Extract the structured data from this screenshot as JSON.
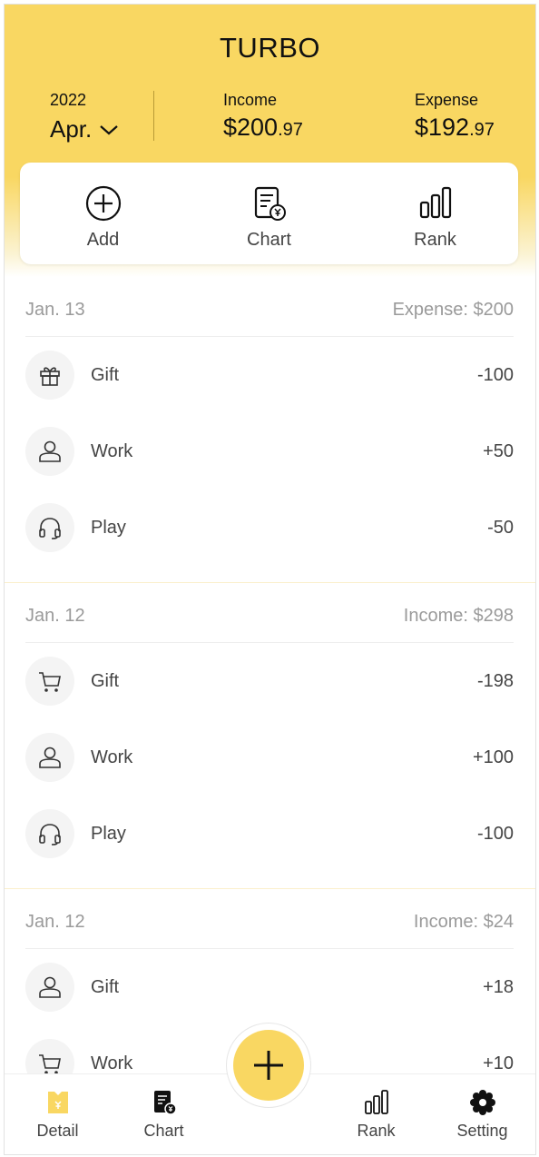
{
  "header": {
    "title": "TURBO",
    "year": "2022",
    "month": "Apr.",
    "income_label": "Income",
    "income_whole": "$200",
    "income_cents": ".97",
    "expense_label": "Expense",
    "expense_whole": "$192",
    "expense_cents": ".97"
  },
  "actions": [
    {
      "label": "Add",
      "icon": "plus-circle-icon"
    },
    {
      "label": "Chart",
      "icon": "chart-doc-icon"
    },
    {
      "label": "Rank",
      "icon": "bar-chart-icon"
    }
  ],
  "groups": [
    {
      "date": "Jan. 13",
      "summary": "Expense: $200",
      "items": [
        {
          "name": "Gift",
          "amount": "-100",
          "icon": "gift-icon"
        },
        {
          "name": "Work",
          "amount": "+50",
          "icon": "user-icon"
        },
        {
          "name": "Play",
          "amount": "-50",
          "icon": "headphones-icon"
        }
      ]
    },
    {
      "date": "Jan. 12",
      "summary": "Income: $298",
      "items": [
        {
          "name": "Gift",
          "amount": "-198",
          "icon": "cart-icon"
        },
        {
          "name": "Work",
          "amount": "+100",
          "icon": "user-icon"
        },
        {
          "name": "Play",
          "amount": "-100",
          "icon": "headphones-icon"
        }
      ]
    },
    {
      "date": "Jan. 12",
      "summary": "Income: $24",
      "items": [
        {
          "name": "Gift",
          "amount": "+18",
          "icon": "user-icon"
        },
        {
          "name": "Work",
          "amount": "+10",
          "icon": "cart-icon"
        }
      ]
    }
  ],
  "tabbar": [
    {
      "label": "Detail",
      "icon": "detail-icon"
    },
    {
      "label": "Chart",
      "icon": "chart-doc-icon"
    },
    {
      "label": "Rank",
      "icon": "bar-chart-icon"
    },
    {
      "label": "Setting",
      "icon": "settings-icon"
    }
  ],
  "colors": {
    "accent": "#f9d762",
    "text": "#444444",
    "muted": "#9a9a9a"
  }
}
